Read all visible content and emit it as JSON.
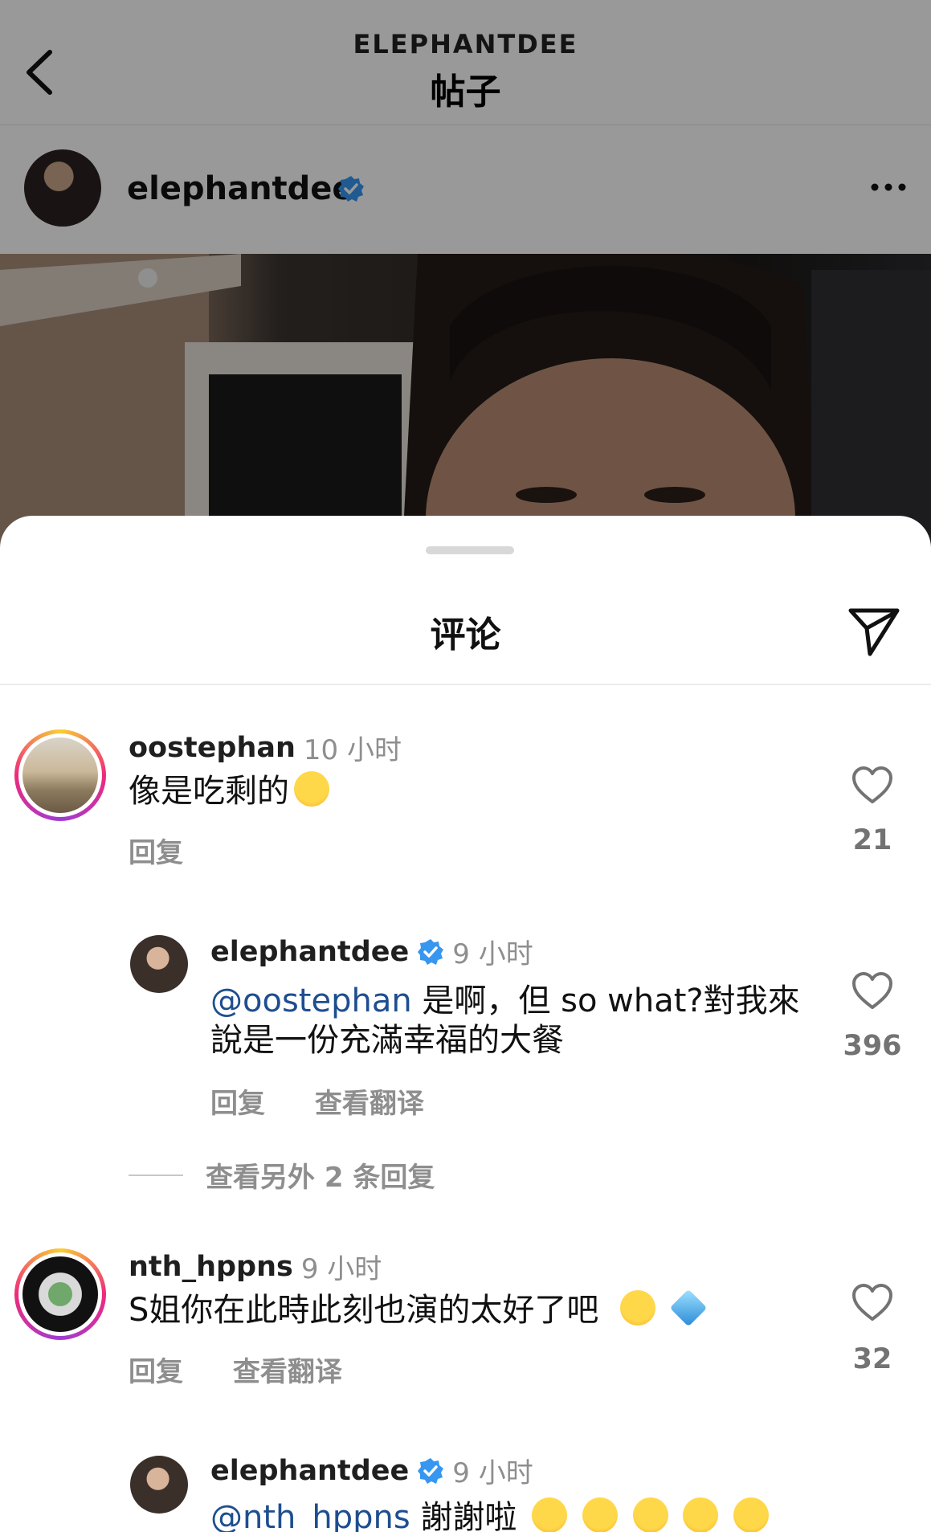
{
  "header": {
    "account": "ELEPHANTDEE",
    "title": "帖子"
  },
  "post": {
    "username": "elephantdee",
    "verified": true
  },
  "comments_sheet": {
    "title": "评论"
  },
  "comments": [
    {
      "username": "oostephan",
      "time": "10 小时",
      "text": "像是吃剩的",
      "emoji": [
        "tears-of-joy"
      ],
      "actions": [
        "回复"
      ],
      "likes": "21"
    },
    {
      "username": "elephantdee",
      "verified": true,
      "time": "9 小时",
      "mention": "@oostephan",
      "text_line1": " 是啊，但 so what?對我來",
      "text_line2": "說是一份充滿幸福的大餐",
      "actions": [
        "回复",
        "查看翻译"
      ],
      "likes": "396"
    },
    {
      "username": "nth_hppns",
      "time": "9 小时",
      "text": "S姐你在此時此刻也演的太好了吧",
      "emoji": [
        "sad-tear",
        "gem"
      ],
      "actions": [
        "回复",
        "查看翻译"
      ],
      "likes": "32"
    },
    {
      "username": "elephantdee",
      "verified": true,
      "time": "9 小时",
      "mention": "@nth_hppns",
      "text": " 謝謝啦",
      "emoji": [
        "crying",
        "crying",
        "crying",
        "crying",
        "crying"
      ]
    }
  ],
  "more_replies": "查看另外 2 条回复",
  "colors": {
    "mention": "#1e4e8f",
    "verified": "#3797f0",
    "muted": "#8e8e8e"
  }
}
